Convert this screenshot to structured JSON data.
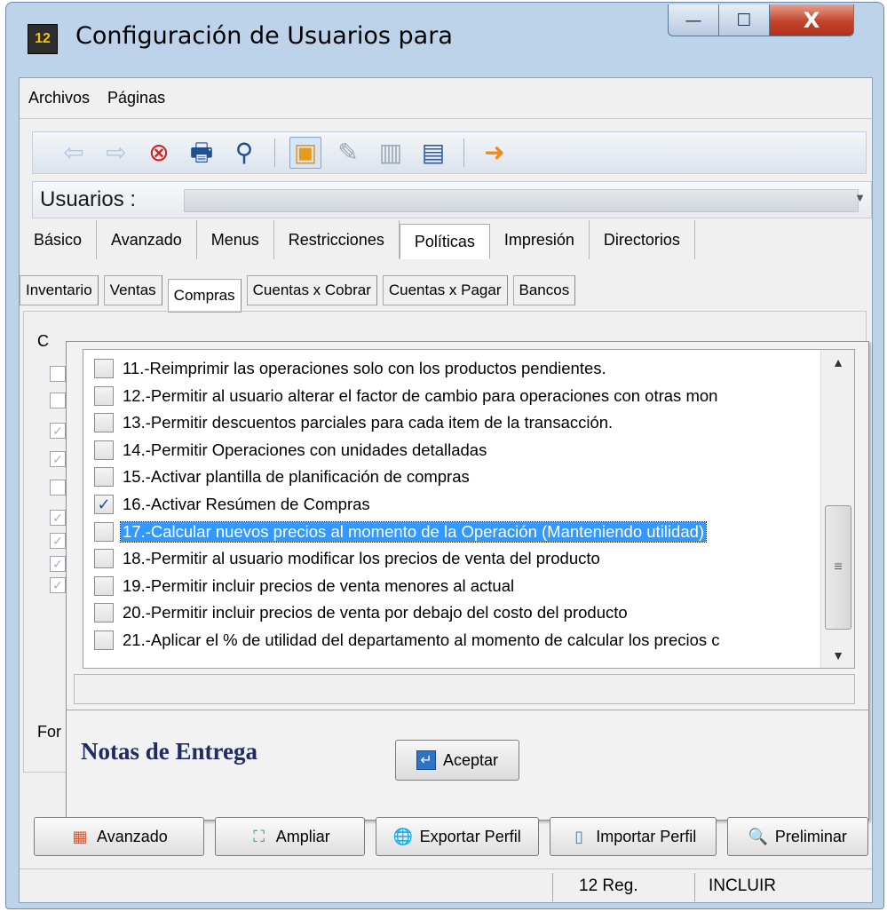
{
  "window": {
    "title": "Configuración de Usuarios para",
    "app_icon_text": "12",
    "controls": {
      "minimize": "—",
      "maximize": "☐",
      "close": "X"
    }
  },
  "menu": {
    "items": [
      "Archivos",
      "Páginas"
    ]
  },
  "toolbar": {
    "icons": [
      "back-arrow-icon",
      "forward-arrow-icon",
      "cancel-icon",
      "print-icon",
      "search-icon",
      "new-document-icon",
      "edit-icon",
      "delete-icon",
      "save-icon",
      "exit-icon"
    ]
  },
  "user_bar": {
    "label": "Usuarios :"
  },
  "tabs_primary": [
    "Básico",
    "Avanzado",
    "Menus",
    "Restricciones",
    "Políticas",
    "Impresión",
    "Directorios"
  ],
  "tabs_primary_selected": "Políticas",
  "tabs_secondary": [
    "Inventario",
    "Ventas",
    "Compras",
    "Cuentas x Cobrar",
    "Cuentas x Pagar",
    "Bancos"
  ],
  "tabs_secondary_selected": "Compras",
  "background_fragments": {
    "left_c": "C",
    "left_for": "For"
  },
  "policy_list": {
    "items": [
      {
        "label": "11.-Reimprimir las operaciones solo con los productos pendientes.",
        "checked": false
      },
      {
        "label": "12.-Permitir al usuario alterar el factor de cambio para operaciones con otras mon",
        "checked": false
      },
      {
        "label": "13.-Permitir descuentos parciales para cada item de la transacción.",
        "checked": false
      },
      {
        "label": "14.-Permitir Operaciones con unidades detalladas",
        "checked": false
      },
      {
        "label": "15.-Activar plantilla de planificación de compras",
        "checked": false
      },
      {
        "label": "16.-Activar Resúmen de Compras",
        "checked": true
      },
      {
        "label": "17.-Calcular nuevos precios al momento de la Operación  (Manteniendo utilidad)",
        "checked": false,
        "highlighted": true
      },
      {
        "label": "18.-Permitir al usuario modificar los precios de venta del producto",
        "checked": false
      },
      {
        "label": "19.-Permitir incluir precios de venta menores al actual",
        "checked": false
      },
      {
        "label": "20.-Permitir incluir precios de venta por debajo del costo del producto",
        "checked": false
      },
      {
        "label": "21.-Aplicar el % de utilidad del departamento al momento de calcular los precios c",
        "checked": false
      }
    ],
    "scroll_position": 0.7
  },
  "dialog": {
    "caption": "Notas de Entrega",
    "accept_button": "Aceptar"
  },
  "bottom_buttons": [
    "Avanzado",
    "Ampliar",
    "Exportar Perfil",
    "Importar Perfil",
    "Preliminar"
  ],
  "statusbar": {
    "records": "12 Reg.",
    "mode": "INCLUIR"
  }
}
